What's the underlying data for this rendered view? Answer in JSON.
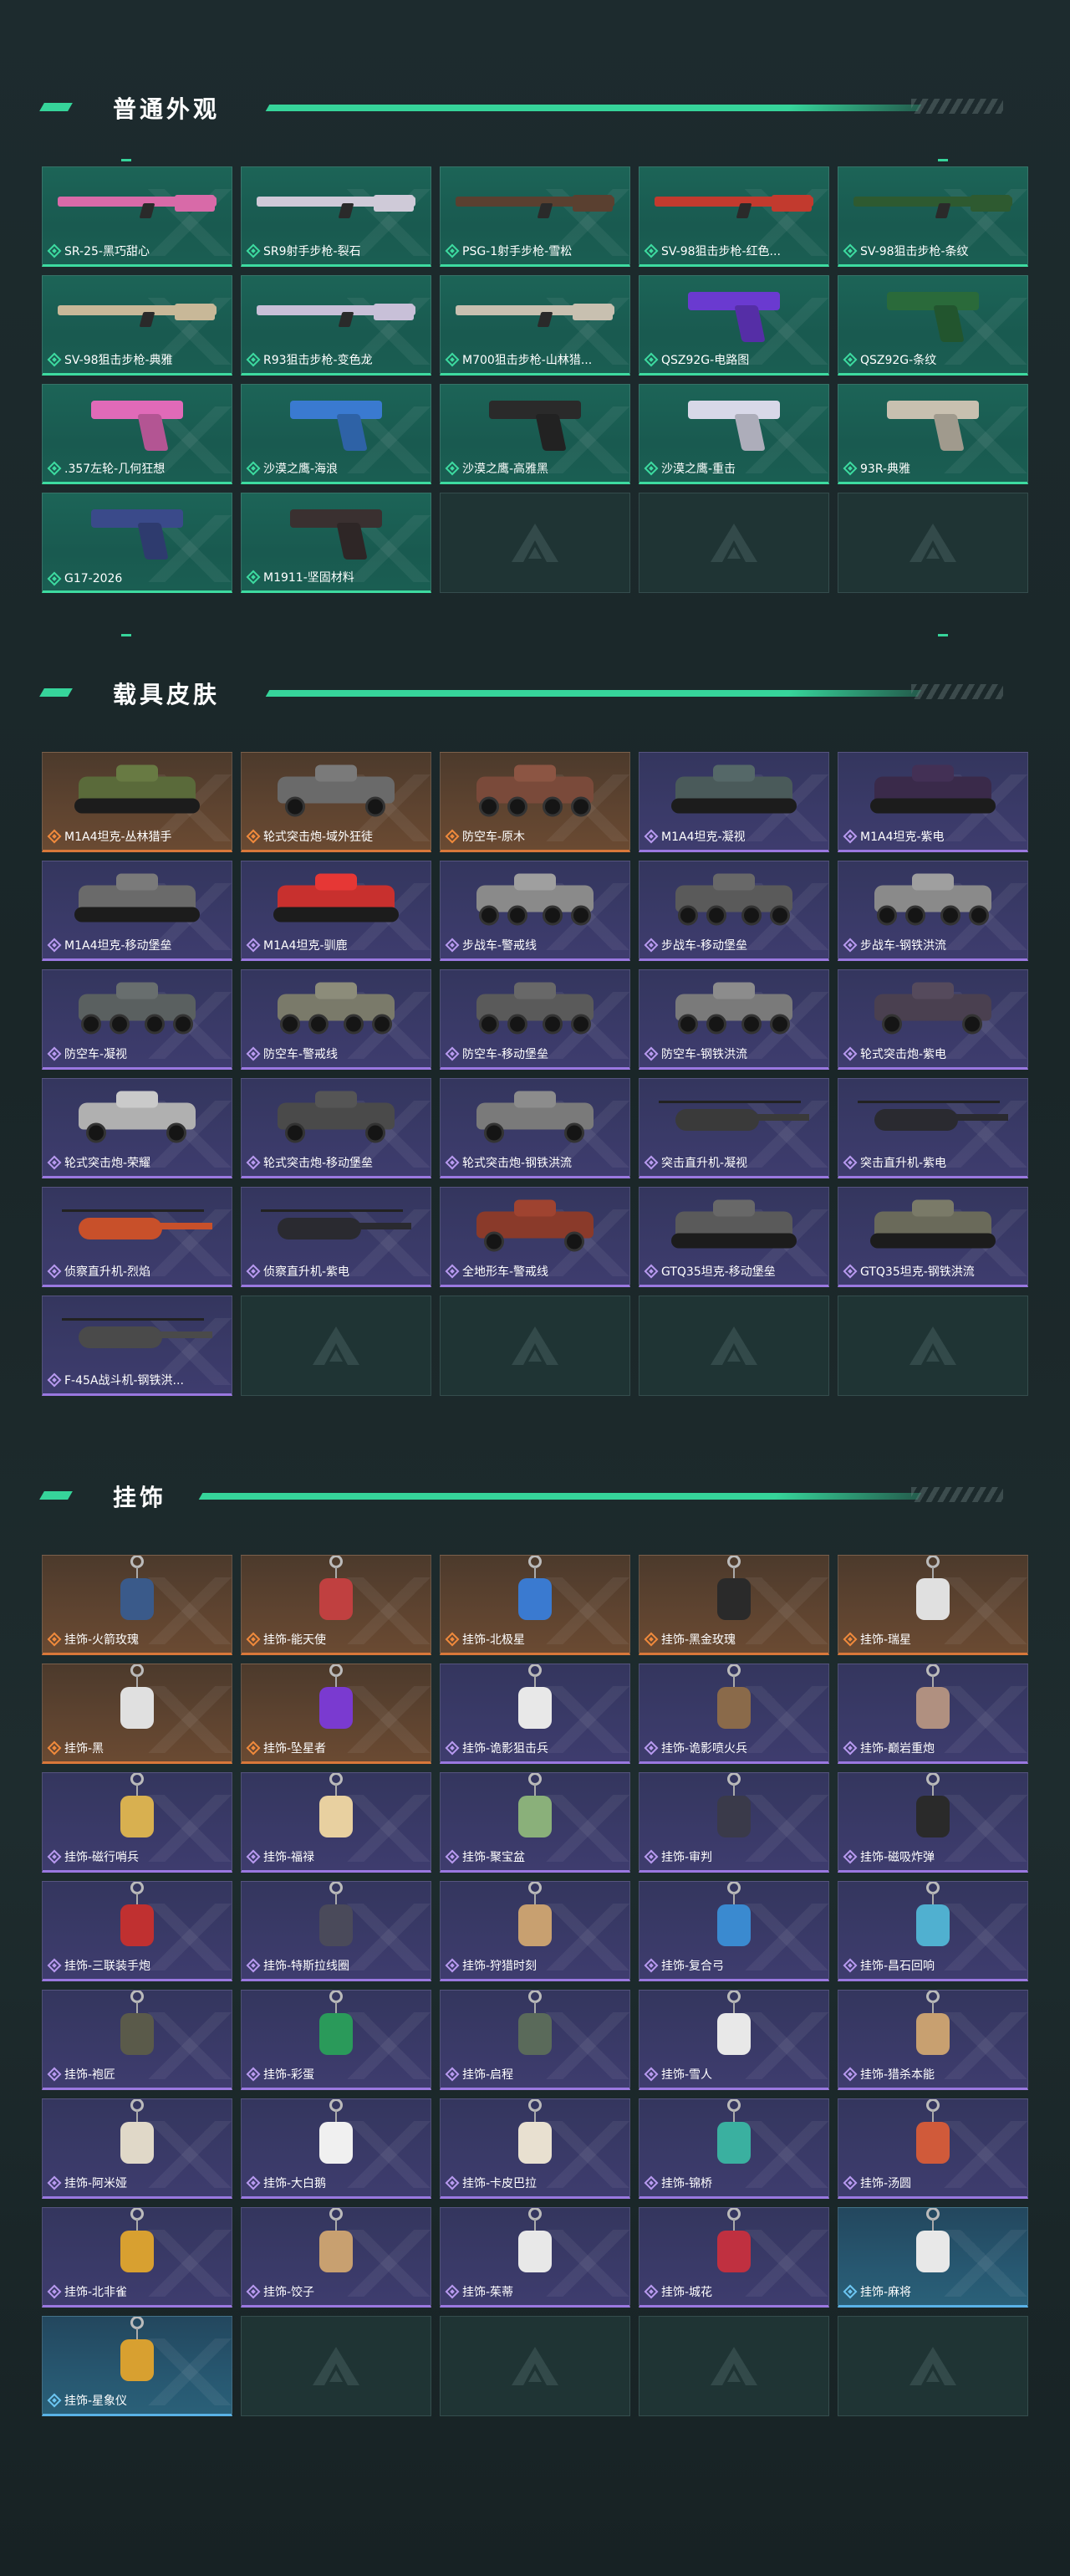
{
  "sections": [
    {
      "title": "普通外观",
      "items": [
        {
          "label": "SR-25-黑巧甜心",
          "rarity": "green",
          "kind": "gun",
          "color": "#d86aa8"
        },
        {
          "label": "SR9射手步枪-裂石",
          "rarity": "green",
          "kind": "gun",
          "color": "#cfcad8"
        },
        {
          "label": "PSG-1射手步枪-雪松",
          "rarity": "green",
          "kind": "gun",
          "color": "#5a4030"
        },
        {
          "label": "SV-98狙击步枪-红色...",
          "rarity": "green",
          "kind": "gun",
          "color": "#c23a2e"
        },
        {
          "label": "SV-98狙击步枪-条纹",
          "rarity": "green",
          "kind": "gun",
          "color": "#2e5a30"
        },
        {
          "label": "SV-98狙击步枪-典雅",
          "rarity": "green",
          "kind": "gun",
          "color": "#c8b898"
        },
        {
          "label": "R93狙击步枪-变色龙",
          "rarity": "green",
          "kind": "gun",
          "color": "#c8c0d8"
        },
        {
          "label": "M700狙击步枪-山林猎...",
          "rarity": "green",
          "kind": "gun",
          "color": "#c8c0b0"
        },
        {
          "label": "QSZ92G-电路图",
          "rarity": "green",
          "kind": "pistol",
          "color": "#6a3ad0"
        },
        {
          "label": "QSZ92G-条纹",
          "rarity": "green",
          "kind": "pistol",
          "color": "#2a6a3a"
        },
        {
          "label": ".357左轮-几何狂想",
          "rarity": "green",
          "kind": "pistol",
          "color": "#e06ab8"
        },
        {
          "label": "沙漠之鹰-海浪",
          "rarity": "green",
          "kind": "pistol",
          "color": "#3a7ad0"
        },
        {
          "label": "沙漠之鹰-高雅黑",
          "rarity": "green",
          "kind": "pistol",
          "color": "#2a2a2a"
        },
        {
          "label": "沙漠之鹰-重击",
          "rarity": "green",
          "kind": "pistol",
          "color": "#d8d8e8"
        },
        {
          "label": "93R-典雅",
          "rarity": "green",
          "kind": "pistol",
          "color": "#c8c0b0"
        },
        {
          "label": "G17-2026",
          "rarity": "green",
          "kind": "pistol",
          "color": "#3a4a8a"
        },
        {
          "label": "M1911-坚固材料",
          "rarity": "green",
          "kind": "pistol",
          "color": "#3a3030"
        }
      ]
    },
    {
      "title": "载具皮肤",
      "items": [
        {
          "label": "M1A4坦克-丛林猎手",
          "rarity": "orange",
          "kind": "tank",
          "color": "#5a6a3a"
        },
        {
          "label": "轮式突击炮-域外狂徒",
          "rarity": "orange",
          "kind": "car",
          "color": "#6a6a6a"
        },
        {
          "label": "防空车-原木",
          "rarity": "orange",
          "kind": "apc",
          "color": "#7a4a3a"
        },
        {
          "label": "M1A4坦克-凝视",
          "rarity": "purple",
          "kind": "tank",
          "color": "#4a5a5a"
        },
        {
          "label": "M1A4坦克-紫电",
          "rarity": "purple",
          "kind": "tank",
          "color": "#3a2a4a"
        },
        {
          "label": "M1A4坦克-移动堡垒",
          "rarity": "purple",
          "kind": "tank",
          "color": "#6a6a6a"
        },
        {
          "label": "M1A4坦克-驯鹿",
          "rarity": "purple",
          "kind": "tank",
          "color": "#c8302e"
        },
        {
          "label": "步战车-警戒线",
          "rarity": "purple",
          "kind": "apc",
          "color": "#8a8a8a"
        },
        {
          "label": "步战车-移动堡垒",
          "rarity": "purple",
          "kind": "apc",
          "color": "#5a5a5a"
        },
        {
          "label": "步战车-钢铁洪流",
          "rarity": "purple",
          "kind": "apc",
          "color": "#8a8a8a"
        },
        {
          "label": "防空车-凝视",
          "rarity": "purple",
          "kind": "apc",
          "color": "#5a6060"
        },
        {
          "label": "防空车-警戒线",
          "rarity": "purple",
          "kind": "apc",
          "color": "#7a7a6a"
        },
        {
          "label": "防空车-移动堡垒",
          "rarity": "purple",
          "kind": "apc",
          "color": "#5a5a5a"
        },
        {
          "label": "防空车-钢铁洪流",
          "rarity": "purple",
          "kind": "apc",
          "color": "#7a7a7a"
        },
        {
          "label": "轮式突击炮-紫电",
          "rarity": "purple",
          "kind": "car",
          "color": "#4a4050"
        },
        {
          "label": "轮式突击炮-荣耀",
          "rarity": "purple",
          "kind": "car",
          "color": "#b0b0b0"
        },
        {
          "label": "轮式突击炮-移动堡垒",
          "rarity": "purple",
          "kind": "car",
          "color": "#4a4a4a"
        },
        {
          "label": "轮式突击炮-钢铁洪流",
          "rarity": "purple",
          "kind": "car",
          "color": "#7a7a7a"
        },
        {
          "label": "突击直升机-凝视",
          "rarity": "purple",
          "kind": "heli",
          "color": "#3a3a3a"
        },
        {
          "label": "突击直升机-紫电",
          "rarity": "purple",
          "kind": "heli",
          "color": "#2a2a30"
        },
        {
          "label": "侦察直升机-烈焰",
          "rarity": "purple",
          "kind": "heli",
          "color": "#c8502a"
        },
        {
          "label": "侦察直升机-紫电",
          "rarity": "purple",
          "kind": "heli",
          "color": "#2a2a30"
        },
        {
          "label": "全地形车-警戒线",
          "rarity": "purple",
          "kind": "car",
          "color": "#8a3a2a"
        },
        {
          "label": "GTQ35坦克-移动堡垒",
          "rarity": "purple",
          "kind": "tank",
          "color": "#5a5a5a"
        },
        {
          "label": "GTQ35坦克-钢铁洪流",
          "rarity": "purple",
          "kind": "tank",
          "color": "#6a6a5a"
        },
        {
          "label": "F-45A战斗机-钢铁洪...",
          "rarity": "purple",
          "kind": "heli",
          "color": "#4a4a4a"
        }
      ]
    },
    {
      "title": "挂饰",
      "items": [
        {
          "label": "挂饰-火箭玫瑰",
          "rarity": "orange",
          "kind": "charm",
          "color": "#3a5a8a"
        },
        {
          "label": "挂饰-能天使",
          "rarity": "orange",
          "kind": "charm",
          "color": "#c04040"
        },
        {
          "label": "挂饰-北极星",
          "rarity": "orange",
          "kind": "charm",
          "color": "#3a7ad0"
        },
        {
          "label": "挂饰-黑金玫瑰",
          "rarity": "orange",
          "kind": "charm",
          "color": "#2a2a2a"
        },
        {
          "label": "挂饰-瑞星",
          "rarity": "orange",
          "kind": "charm",
          "color": "#e0e0e0"
        },
        {
          "label": "挂饰-黑",
          "rarity": "orange",
          "kind": "charm",
          "color": "#e0e0e0"
        },
        {
          "label": "挂饰-坠星者",
          "rarity": "orange",
          "kind": "charm",
          "color": "#7a3ad0"
        },
        {
          "label": "挂饰-诡影狙击兵",
          "rarity": "purple",
          "kind": "charm",
          "color": "#e8e8e8"
        },
        {
          "label": "挂饰-诡影喷火兵",
          "rarity": "purple",
          "kind": "charm",
          "color": "#8a6a4a"
        },
        {
          "label": "挂饰-巅岩重炮",
          "rarity": "purple",
          "kind": "charm",
          "color": "#b09080"
        },
        {
          "label": "挂饰-磁行哨兵",
          "rarity": "purple",
          "kind": "charm",
          "color": "#d8b050"
        },
        {
          "label": "挂饰-福禄",
          "rarity": "purple",
          "kind": "charm",
          "color": "#e8d0a0"
        },
        {
          "label": "挂饰-聚宝盆",
          "rarity": "purple",
          "kind": "charm",
          "color": "#8ab07a"
        },
        {
          "label": "挂饰-审判",
          "rarity": "purple",
          "kind": "charm",
          "color": "#3a3a4a"
        },
        {
          "label": "挂饰-磁吸炸弹",
          "rarity": "purple",
          "kind": "charm",
          "color": "#2a2a2a"
        },
        {
          "label": "挂饰-三联装手炮",
          "rarity": "purple",
          "kind": "charm",
          "color": "#c03030"
        },
        {
          "label": "挂饰-特斯拉线圈",
          "rarity": "purple",
          "kind": "charm",
          "color": "#4a4a5a"
        },
        {
          "label": "挂饰-狩猎时刻",
          "rarity": "purple",
          "kind": "charm",
          "color": "#c8a070"
        },
        {
          "label": "挂饰-复合弓",
          "rarity": "purple",
          "kind": "charm",
          "color": "#3a8ad0"
        },
        {
          "label": "挂饰-昌石回响",
          "rarity": "purple",
          "kind": "charm",
          "color": "#50b0d0"
        },
        {
          "label": "挂饰-袍匠",
          "rarity": "purple",
          "kind": "charm",
          "color": "#5a5a4a"
        },
        {
          "label": "挂饰-彩蛋",
          "rarity": "purple",
          "kind": "charm",
          "color": "#2a9a5a"
        },
        {
          "label": "挂饰-启程",
          "rarity": "purple",
          "kind": "charm",
          "color": "#5a6a5a"
        },
        {
          "label": "挂饰-雪人",
          "rarity": "purple",
          "kind": "charm",
          "color": "#e8e8e8"
        },
        {
          "label": "挂饰-猎杀本能",
          "rarity": "purple",
          "kind": "charm",
          "color": "#c8a070"
        },
        {
          "label": "挂饰-阿米娅",
          "rarity": "purple",
          "kind": "charm",
          "color": "#e0d8c8"
        },
        {
          "label": "挂饰-大白鹅",
          "rarity": "purple",
          "kind": "charm",
          "color": "#f0f0f0"
        },
        {
          "label": "挂饰-卡皮巴拉",
          "rarity": "purple",
          "kind": "charm",
          "color": "#e8e0d0"
        },
        {
          "label": "挂饰-锦桥",
          "rarity": "purple",
          "kind": "charm",
          "color": "#3ab0a0"
        },
        {
          "label": "挂饰-汤圆",
          "rarity": "purple",
          "kind": "charm",
          "color": "#d05a3a"
        },
        {
          "label": "挂饰-北非雀",
          "rarity": "purple",
          "kind": "charm",
          "color": "#d8a030"
        },
        {
          "label": "挂饰-饺子",
          "rarity": "purple",
          "kind": "charm",
          "color": "#c8a070"
        },
        {
          "label": "挂饰-茱蒂",
          "rarity": "purple",
          "kind": "charm",
          "color": "#e8e8e8"
        },
        {
          "label": "挂饰-城花",
          "rarity": "purple",
          "kind": "charm",
          "color": "#c03040"
        },
        {
          "label": "挂饰-麻将",
          "rarity": "blue",
          "kind": "charm",
          "color": "#e8e8e8"
        },
        {
          "label": "挂饰-星象仪",
          "rarity": "blue",
          "kind": "charm",
          "color": "#d8a030"
        }
      ]
    }
  ]
}
